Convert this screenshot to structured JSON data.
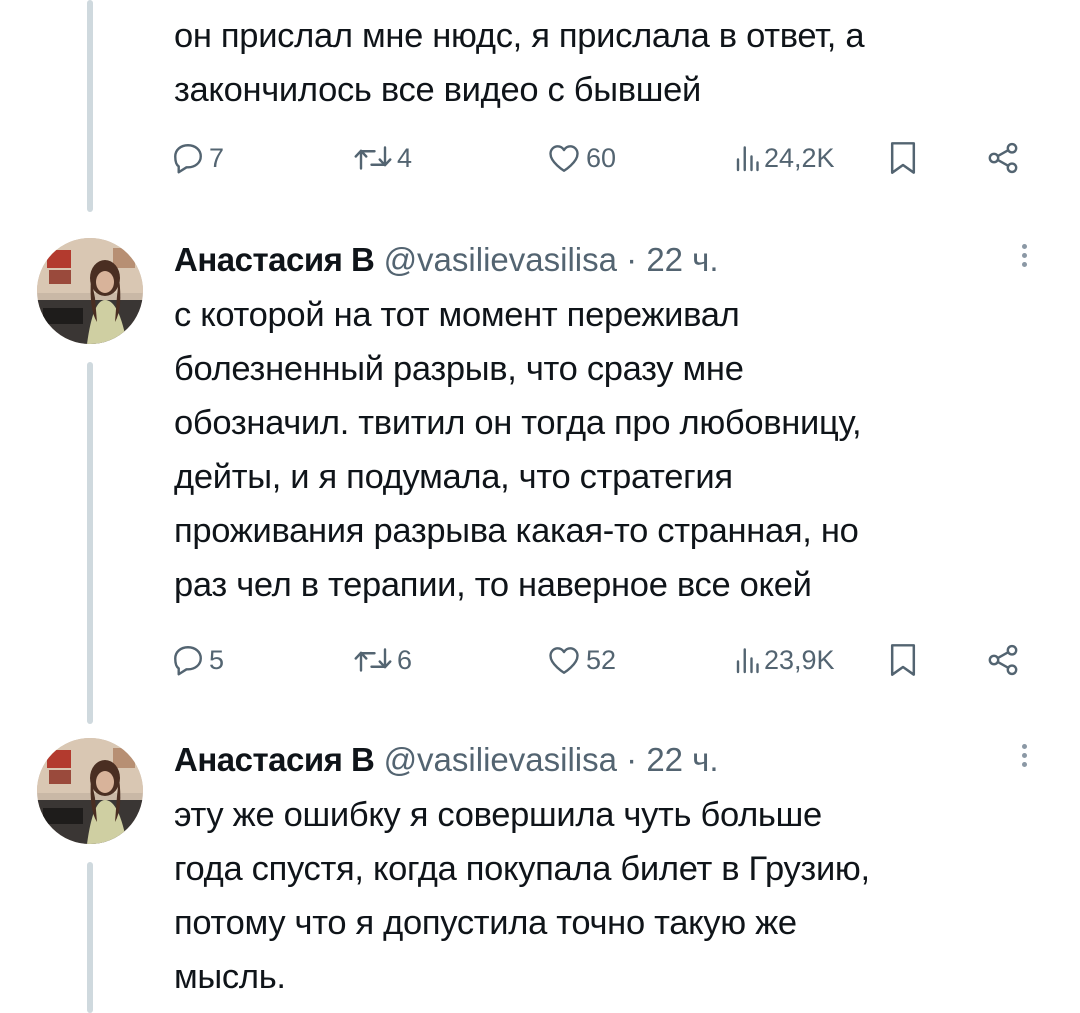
{
  "tweets": [
    {
      "text_lines": [
        "он прислал мне нюдс, я прислала в ответ, а",
        "закончилось все видео с бывшей"
      ],
      "actions": {
        "replies": "7",
        "retweets": "4",
        "likes": "60",
        "views": "24,2K"
      }
    },
    {
      "author": {
        "name": "Анастасия В",
        "handle": "@vasilievasilisa",
        "separator": "·",
        "time": "22 ч."
      },
      "text_lines": [
        "с которой на тот момент переживал",
        "болезненный разрыв, что сразу мне",
        "обозначил. твитил он тогда про любовницу,",
        "дейты, и я подумала, что стратегия",
        "проживания разрыва какая-то странная, но",
        "раз чел в терапии, то наверное все окей"
      ],
      "actions": {
        "replies": "5",
        "retweets": "6",
        "likes": "52",
        "views": "23,9K"
      }
    },
    {
      "author": {
        "name": "Анастасия В",
        "handle": "@vasilievasilisa",
        "separator": "·",
        "time": "22 ч."
      },
      "text_lines": [
        "эту же ошибку я совершила чуть больше",
        "года спустя, когда покупала билет в Грузию,",
        "потому что я допустила точно такую же",
        "мысль."
      ]
    }
  ],
  "icons": {
    "reply": "reply-icon",
    "retweet": "retweet-icon",
    "like": "heart-icon",
    "views": "views-icon",
    "bookmark": "bookmark-icon",
    "share": "share-icon",
    "more": "more-icon"
  },
  "colors": {
    "text": "#0f1419",
    "secondary": "#536471",
    "thread_line": "#cfd9de",
    "background": "#ffffff"
  }
}
